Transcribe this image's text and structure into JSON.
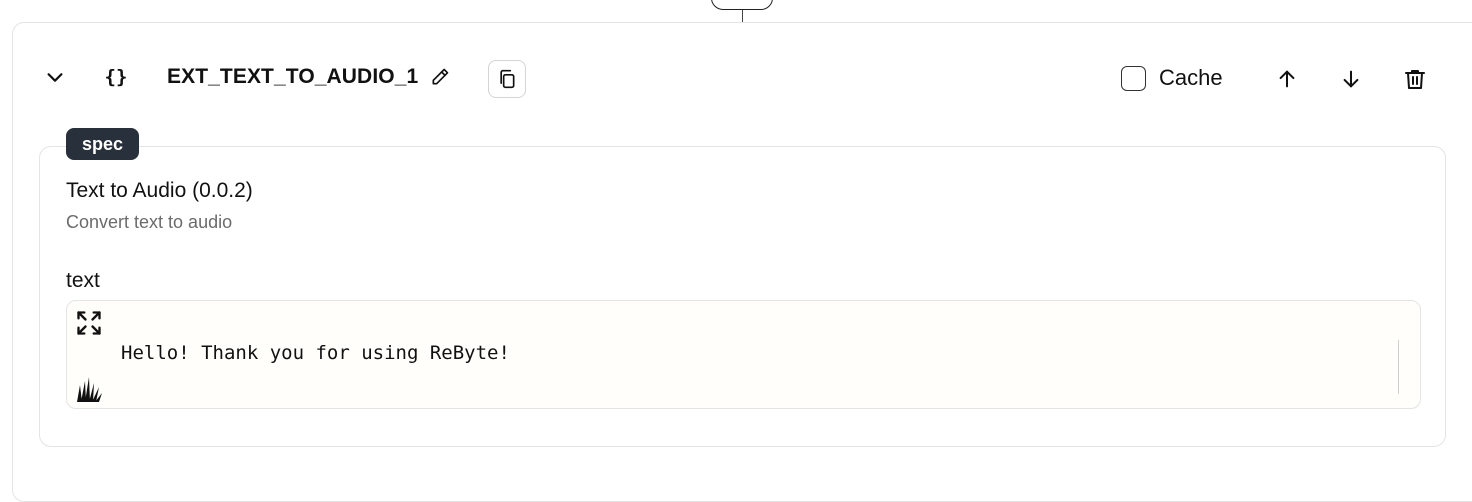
{
  "block": {
    "name": "EXT_TEXT_TO_AUDIO_1",
    "cache_label": "Cache",
    "cache_checked": false
  },
  "spec": {
    "badge": "spec",
    "title": "Text to Audio (0.0.2)",
    "description": "Convert text to audio"
  },
  "field": {
    "label": "text",
    "value": "Hello! Thank you for using ReByte!"
  },
  "icons": {
    "braces": "{}",
    "collapse": "chevron-down-icon",
    "edit": "pencil-icon",
    "copy": "copy-icon",
    "move_up": "arrow-up-icon",
    "move_down": "arrow-down-icon",
    "delete": "trash-icon",
    "expand": "expand-icon",
    "grass": "grass-icon"
  }
}
